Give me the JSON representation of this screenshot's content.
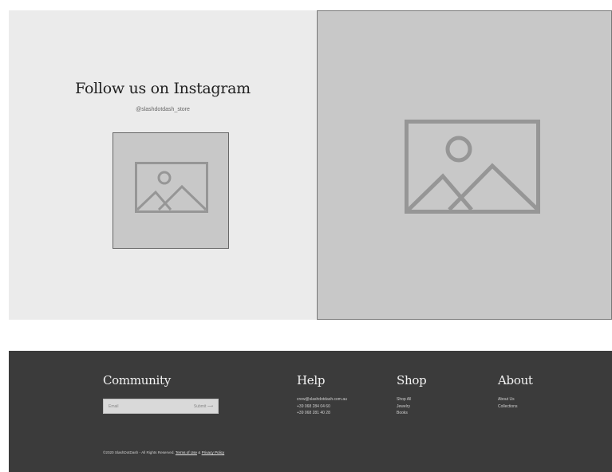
{
  "instagram": {
    "title": "Follow us on Instagram",
    "handle": "@slashdotdash_store",
    "thumbnail_icon": "image-placeholder-icon",
    "feature_icon": "image-placeholder-icon"
  },
  "footer": {
    "community": {
      "heading": "Community",
      "email_placeholder": "Email",
      "submit_label": "Submit",
      "submit_icon": "arrow-right-icon"
    },
    "help": {
      "heading": "Help",
      "lines": [
        "crew@slashdotdash.com.au",
        "+39 068 284 04 60",
        "+39 068 281 40 28"
      ]
    },
    "shop": {
      "heading": "Shop",
      "items": [
        "Shop All",
        "Jewelry",
        "Books"
      ]
    },
    "about": {
      "heading": "About",
      "items": [
        "About Us",
        "Collections"
      ]
    },
    "legal": {
      "copyright": "©2020 SlashDotDash - All Rights Reserved.",
      "terms_label": "Terms of Use",
      "separator": "&",
      "privacy_label": "Privacy Policy"
    }
  },
  "colors": {
    "footer_bg": "#3b3b3b",
    "left_panel_bg": "#ebebeb",
    "placeholder_bg": "#c8c8c8"
  }
}
